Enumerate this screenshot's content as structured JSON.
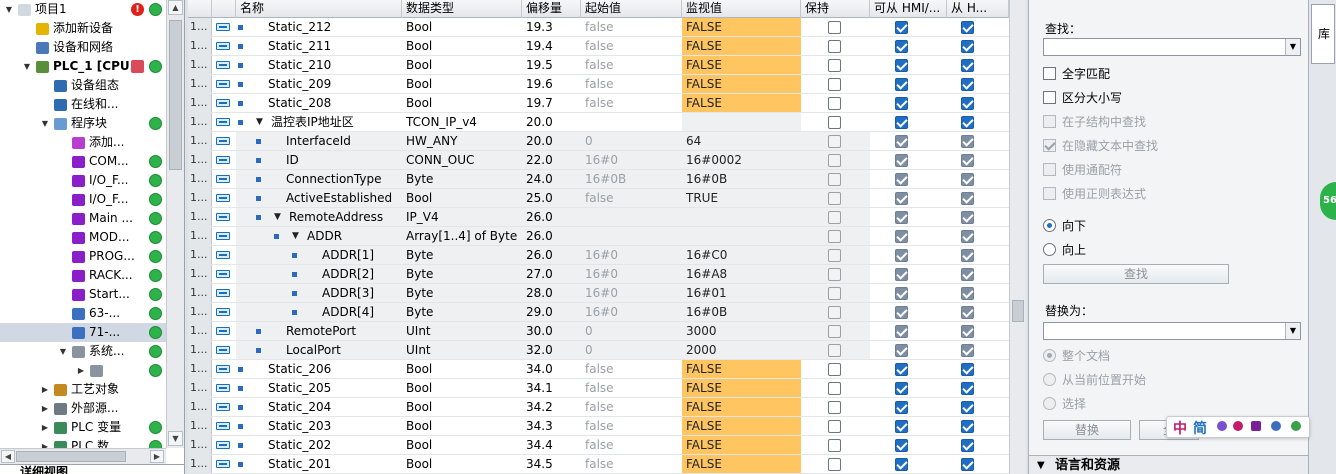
{
  "tree": {
    "rows": [
      {
        "label": "项目1",
        "indent": 0,
        "exp": "▼",
        "icon": "#d0d8e0",
        "status": ""
      },
      {
        "label": "添加新设备",
        "indent": 1,
        "exp": "",
        "icon": "#e4b400",
        "status": ""
      },
      {
        "label": "设备和网络",
        "indent": 1,
        "exp": "",
        "icon": "#4a78b8",
        "status": ""
      },
      {
        "label": "PLC_1 [CPU...",
        "indent": 1,
        "exp": "▼",
        "icon": "#5a8f3a",
        "status": "green",
        "bold": true
      },
      {
        "label": "设备组态",
        "indent": 2,
        "exp": "",
        "icon": "#2f6bb0",
        "status": ""
      },
      {
        "label": "在线和...",
        "indent": 2,
        "exp": "",
        "icon": "#2f6bb0",
        "status": ""
      },
      {
        "label": "程序块",
        "indent": 2,
        "exp": "▼",
        "icon": "#6a9ad4",
        "status": "green"
      },
      {
        "label": "添加...",
        "indent": 3,
        "exp": "",
        "icon": "#b63fd0",
        "status": ""
      },
      {
        "label": "COM...",
        "indent": 3,
        "exp": "",
        "icon": "#8a1fc9",
        "status": "green"
      },
      {
        "label": "I/O_F...",
        "indent": 3,
        "exp": "",
        "icon": "#8a1fc9",
        "status": "green"
      },
      {
        "label": "I/O_F...",
        "indent": 3,
        "exp": "",
        "icon": "#8a1fc9",
        "status": "green"
      },
      {
        "label": "Main ...",
        "indent": 3,
        "exp": "",
        "icon": "#8a1fc9",
        "status": "green"
      },
      {
        "label": "MOD...",
        "indent": 3,
        "exp": "",
        "icon": "#8a1fc9",
        "status": "green"
      },
      {
        "label": "PROG...",
        "indent": 3,
        "exp": "",
        "icon": "#8a1fc9",
        "status": "green"
      },
      {
        "label": "RACK...",
        "indent": 3,
        "exp": "",
        "icon": "#8a1fc9",
        "status": "green"
      },
      {
        "label": "Start...",
        "indent": 3,
        "exp": "",
        "icon": "#8a1fc9",
        "status": "green"
      },
      {
        "label": "63-...",
        "indent": 3,
        "exp": "",
        "icon": "#3c6fc0",
        "status": "green"
      },
      {
        "label": "71-...",
        "indent": 3,
        "exp": "",
        "icon": "#3c6fc0",
        "status": "green",
        "sel": true
      },
      {
        "label": "系统...",
        "indent": 3,
        "exp": "▼",
        "icon": "#8a949e",
        "status": "green"
      },
      {
        "label": "",
        "indent": 4,
        "exp": "▶",
        "icon": "#8a949e",
        "status": "green"
      },
      {
        "label": "工艺对象",
        "indent": 2,
        "exp": "▶",
        "icon": "#c58a1f",
        "status": ""
      },
      {
        "label": "外部源...",
        "indent": 2,
        "exp": "▶",
        "icon": "#6d7a86",
        "status": ""
      },
      {
        "label": "PLC 变量",
        "indent": 2,
        "exp": "▶",
        "icon": "#3a8a5a",
        "status": "green"
      },
      {
        "label": "PLC 数...",
        "indent": 2,
        "exp": "▶",
        "icon": "#3a8a5a",
        "status": "green"
      }
    ],
    "footer": "详细视图"
  },
  "table": {
    "headers": [
      "名称",
      "数据类型",
      "偏移量",
      "起始值",
      "监视值",
      "保持",
      "可从 HMI/...",
      "从 H..."
    ],
    "rows": [
      {
        "num": "1...",
        "name": "Static_212",
        "type": "Bool",
        "offset": "19.3",
        "start": "false",
        "monitor": "FALSE",
        "level": 0,
        "hmi": true,
        "from": true
      },
      {
        "num": "1...",
        "name": "Static_211",
        "type": "Bool",
        "offset": "19.4",
        "start": "false",
        "monitor": "FALSE",
        "level": 0,
        "hmi": true,
        "from": true
      },
      {
        "num": "1...",
        "name": "Static_210",
        "type": "Bool",
        "offset": "19.5",
        "start": "false",
        "monitor": "FALSE",
        "level": 0,
        "hmi": true,
        "from": true
      },
      {
        "num": "1...",
        "name": "Static_209",
        "type": "Bool",
        "offset": "19.6",
        "start": "false",
        "monitor": "FALSE",
        "level": 0,
        "hmi": true,
        "from": true
      },
      {
        "num": "1...",
        "name": "Static_208",
        "type": "Bool",
        "offset": "19.7",
        "start": "false",
        "monitor": "FALSE",
        "level": 0,
        "hmi": true,
        "from": true
      },
      {
        "num": "1...",
        "name": "温控表IP地址区",
        "type": "TCON_IP_v4",
        "offset": "20.0",
        "start": "",
        "monitor": "",
        "level": 0,
        "expand": true,
        "hmi": true,
        "from": true
      },
      {
        "num": "1...",
        "name": "InterfaceId",
        "type": "HW_ANY",
        "offset": "20.0",
        "start": "0",
        "monitor": "64",
        "level": 1,
        "hmi": true,
        "from": true,
        "gray": true
      },
      {
        "num": "1...",
        "name": "ID",
        "type": "CONN_OUC",
        "offset": "22.0",
        "start": "16#0",
        "monitor": "16#0002",
        "level": 1,
        "hmi": true,
        "from": true,
        "gray": true
      },
      {
        "num": "1...",
        "name": "ConnectionType",
        "type": "Byte",
        "offset": "24.0",
        "start": "16#0B",
        "monitor": "16#0B",
        "level": 1,
        "hmi": true,
        "from": true,
        "gray": true
      },
      {
        "num": "1...",
        "name": "ActiveEstablished",
        "type": "Bool",
        "offset": "25.0",
        "start": "false",
        "monitor": "TRUE",
        "level": 1,
        "hmi": true,
        "from": true,
        "gray": true
      },
      {
        "num": "1...",
        "name": "RemoteAddress",
        "type": "IP_V4",
        "offset": "26.0",
        "start": "",
        "monitor": "",
        "level": 1,
        "expand": true,
        "hmi": true,
        "from": true,
        "gray": true
      },
      {
        "num": "1...",
        "name": "ADDR",
        "type": "Array[1..4] of Byte",
        "offset": "26.0",
        "start": "",
        "monitor": "",
        "level": 2,
        "expand": true,
        "hmi": true,
        "from": true,
        "gray": true
      },
      {
        "num": "1...",
        "name": "ADDR[1]",
        "type": "Byte",
        "offset": "26.0",
        "start": "16#0",
        "monitor": "16#C0",
        "level": 3,
        "hmi": true,
        "from": true,
        "gray": true
      },
      {
        "num": "1...",
        "name": "ADDR[2]",
        "type": "Byte",
        "offset": "27.0",
        "start": "16#0",
        "monitor": "16#A8",
        "level": 3,
        "hmi": true,
        "from": true,
        "gray": true
      },
      {
        "num": "1...",
        "name": "ADDR[3]",
        "type": "Byte",
        "offset": "28.0",
        "start": "16#0",
        "monitor": "16#01",
        "level": 3,
        "hmi": true,
        "from": true,
        "gray": true
      },
      {
        "num": "1...",
        "name": "ADDR[4]",
        "type": "Byte",
        "offset": "29.0",
        "start": "16#0",
        "monitor": "16#0B",
        "level": 3,
        "hmi": true,
        "from": true,
        "gray": true
      },
      {
        "num": "1...",
        "name": "RemotePort",
        "type": "UInt",
        "offset": "30.0",
        "start": "0",
        "monitor": "3000",
        "level": 1,
        "hmi": true,
        "from": true,
        "gray": true
      },
      {
        "num": "1...",
        "name": "LocalPort",
        "type": "UInt",
        "offset": "32.0",
        "start": "0",
        "monitor": "2000",
        "level": 1,
        "hmi": true,
        "from": true,
        "gray": true
      },
      {
        "num": "1...",
        "name": "Static_206",
        "type": "Bool",
        "offset": "34.0",
        "start": "false",
        "monitor": "FALSE",
        "level": 0,
        "hmi": true,
        "from": true
      },
      {
        "num": "1...",
        "name": "Static_205",
        "type": "Bool",
        "offset": "34.1",
        "start": "false",
        "monitor": "FALSE",
        "level": 0,
        "hmi": true,
        "from": true
      },
      {
        "num": "1...",
        "name": "Static_204",
        "type": "Bool",
        "offset": "34.2",
        "start": "false",
        "monitor": "FALSE",
        "level": 0,
        "hmi": true,
        "from": true
      },
      {
        "num": "1...",
        "name": "Static_203",
        "type": "Bool",
        "offset": "34.3",
        "start": "false",
        "monitor": "FALSE",
        "level": 0,
        "hmi": true,
        "from": true
      },
      {
        "num": "1...",
        "name": "Static_202",
        "type": "Bool",
        "offset": "34.4",
        "start": "false",
        "monitor": "FALSE",
        "level": 0,
        "hmi": true,
        "from": true
      },
      {
        "num": "1...",
        "name": "Static_201",
        "type": "Bool",
        "offset": "34.5",
        "start": "false",
        "monitor": "FALSE",
        "level": 0,
        "hmi": true,
        "from": true
      }
    ]
  },
  "panel": {
    "find_label": "查找：",
    "find_value": "",
    "options": [
      {
        "label": "全字匹配",
        "checked": false,
        "disabled": false
      },
      {
        "label": "区分大小写",
        "checked": false,
        "disabled": false
      },
      {
        "label": "在子结构中查找",
        "checked": false,
        "disabled": true
      },
      {
        "label": "在隐藏文本中查找",
        "checked": true,
        "disabled": true
      },
      {
        "label": "使用通配符",
        "checked": false,
        "disabled": true
      },
      {
        "label": "使用正则表达式",
        "checked": false,
        "disabled": true
      }
    ],
    "direction": [
      {
        "label": "向下",
        "checked": true
      },
      {
        "label": "向上",
        "checked": false
      }
    ],
    "find_button": "查找",
    "replace_label": "替换为：",
    "replace_value": "",
    "scope": [
      {
        "label": "整个文档",
        "checked": true
      },
      {
        "label": "从当前位置开始",
        "checked": false
      },
      {
        "label": "选择",
        "checked": false
      }
    ],
    "replace_button": "替换",
    "replace_all_button": "全",
    "lang_section": "语言和资源",
    "side_tab": "库",
    "badge": "56"
  },
  "ime": {
    "chinese": "中",
    "simp": "简"
  }
}
